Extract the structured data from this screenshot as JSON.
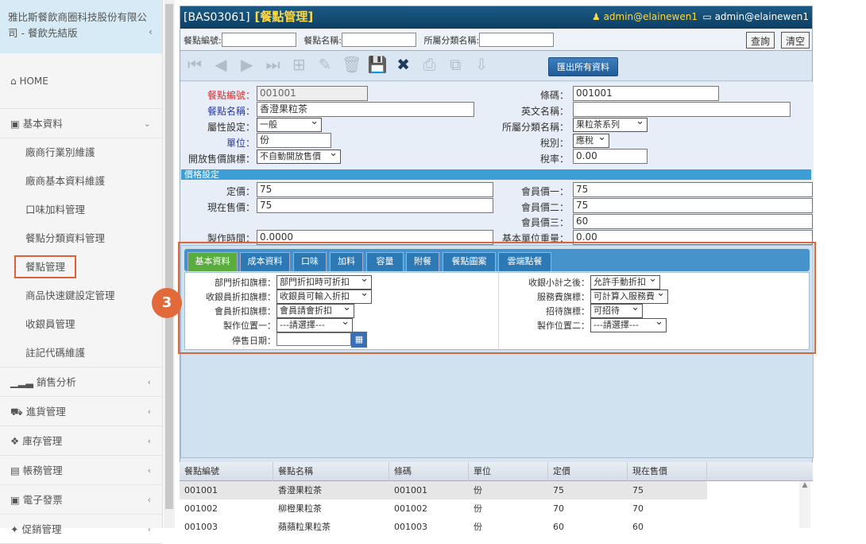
{
  "sidebar": {
    "company": "雅比斯餐飲商圈科技股份有限公司 - 餐飲先結版",
    "home": "HOME",
    "basic": "基本資料",
    "subitems": [
      "廠商行業別維護",
      "廠商基本資料維護",
      "口味加料管理",
      "餐點分類資料管理",
      "餐點管理",
      "商品快速鍵設定管理",
      "收銀員管理",
      "註記代碼維護"
    ],
    "groups": [
      "銷售分析",
      "進貨管理",
      "庫存管理",
      "帳務管理",
      "電子發票",
      "促銷管理"
    ]
  },
  "header": {
    "code": "[BAS03061]",
    "name": "[餐點管理]",
    "user1": "admin@elainewen1",
    "user2": "admin@elainewen1"
  },
  "search": {
    "label1": "餐點編號:",
    "label2": "餐點名稱:",
    "label3": "所屬分類名稱:",
    "query": "查詢",
    "clear": "清空"
  },
  "toolbar": {
    "export": "匯出所有資料"
  },
  "form": {
    "l_id": "餐點編號：",
    "v_id": "001001",
    "l_name": "餐點名稱：",
    "v_name": "香澄果粒茶",
    "l_attr": "屬性設定：",
    "v_attr": "一般",
    "l_unit": "單位：",
    "v_unit": "份",
    "l_open": "開放售價旗標：",
    "v_open": "不自動開放售價",
    "l_barcode": "條碼：",
    "v_barcode": "001001",
    "l_en": "英文名稱：",
    "v_en": "",
    "l_cat": "所屬分類名稱：",
    "v_cat": "果粒茶系列",
    "l_tax": "稅別：",
    "v_tax": "應稅",
    "l_taxrate": "稅率：",
    "v_taxrate": "0.00",
    "price_section": "價格設定",
    "l_list": "定價：",
    "v_list": "75",
    "l_cur": "現在售價：",
    "v_cur": "75",
    "l_m1": "會員價一：",
    "v_m1": "75",
    "l_m2": "會員價二：",
    "v_m2": "75",
    "l_m3": "會員價三：",
    "v_m3": "60",
    "l_time": "製作時間：",
    "v_time": "0.0000",
    "l_weight": "基本單位重量：",
    "v_weight": "0.00"
  },
  "tabs": [
    "基本資料",
    "成本資料",
    "口味",
    "加料",
    "容量",
    "附餐",
    "餐點圖案",
    "雲端點餐"
  ],
  "tabform": {
    "l_dept": "部門折扣旗標：",
    "v_dept": "部門折扣時可折扣",
    "l_cashier": "收銀員折扣旗標：",
    "v_cashier": "收銀員可輸入折扣",
    "l_member": "會員折扣旗標：",
    "v_member": "會員請會折扣",
    "l_pos1": "製作位置一：",
    "v_pos1": "---請選擇---",
    "l_stop": "停售日期：",
    "l_sub": "收銀小計之後：",
    "v_sub": "允許手動折扣",
    "l_svc": "服務費旗標：",
    "v_svc": "可計算入服務費",
    "l_treat": "招待旗標：",
    "v_treat": "可招待",
    "l_pos2": "製作位置二：",
    "v_pos2": "---請選擇---"
  },
  "badge": "3",
  "table": {
    "headers": [
      "餐點編號",
      "餐點名稱",
      "條碼",
      "單位",
      "定價",
      "現在售價"
    ],
    "rows": [
      [
        "001001",
        "香澄果粒茶",
        "001001",
        "份",
        "75",
        "75"
      ],
      [
        "001002",
        "柳橙果粒茶",
        "001002",
        "份",
        "70",
        "70"
      ],
      [
        "001003",
        "蘋蘋粒果粒茶",
        "001003",
        "份",
        "60",
        "60"
      ]
    ]
  }
}
